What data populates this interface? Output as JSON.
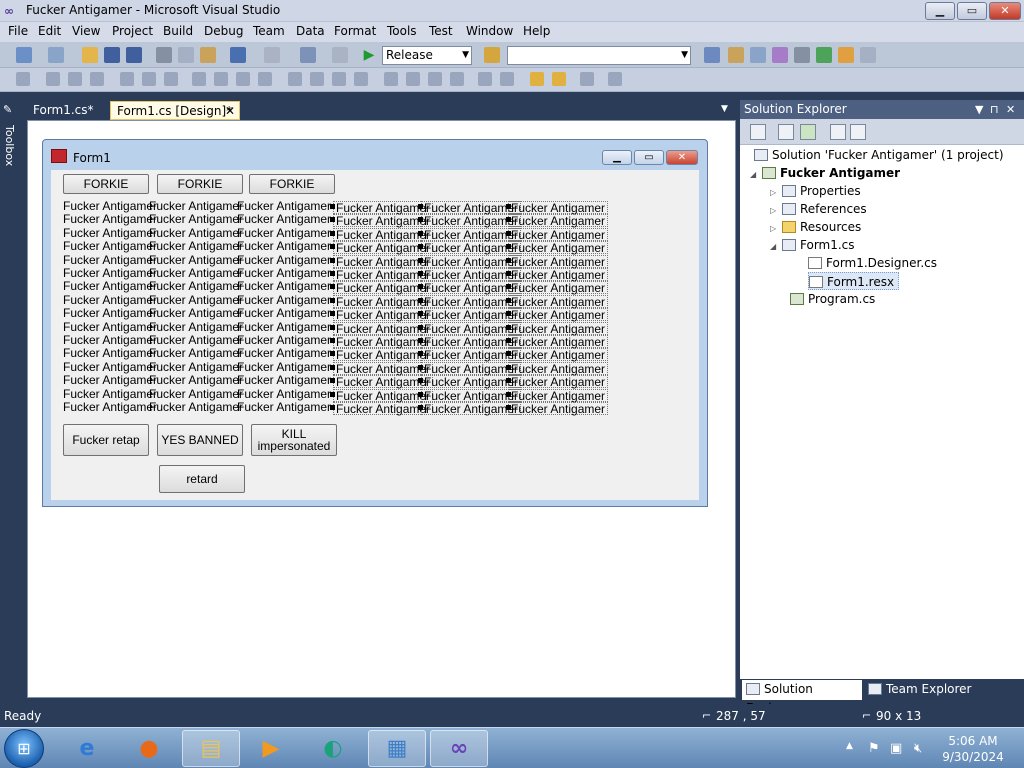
{
  "window": {
    "title": "Fucker Antigamer - Microsoft Visual Studio",
    "minimize": "▁",
    "maximize": "▭",
    "close": "✕"
  },
  "menu": [
    "File",
    "Edit",
    "View",
    "Project",
    "Build",
    "Debug",
    "Team",
    "Data",
    "Format",
    "Tools",
    "Test",
    "Window",
    "Help"
  ],
  "toolbar": {
    "config": "Release",
    "platform": ""
  },
  "toolbox_label": "Toolbox",
  "doc_tabs": {
    "tab1": "Form1.cs*",
    "tab2": "Form1.cs [Design]*",
    "tab2_close": "✕",
    "dropdown": "▼"
  },
  "form": {
    "title": "Form1",
    "top_buttons": [
      "FORKIE",
      "FORKIE",
      "FORKIE"
    ],
    "label_text": "Fucker Antigamer",
    "bottom_buttons": {
      "fucker_retap": "Fucker retap",
      "yes_banned": "YES BANNED",
      "kill_line1": "KILL",
      "kill_line2": "impersonated",
      "retard": "retard"
    }
  },
  "solution_explorer": {
    "title": "Solution Explorer",
    "pin": "⊓",
    "close": "✕",
    "dropdown": "▼",
    "tree": {
      "solution": "Solution 'Fucker Antigamer' (1 project)",
      "project": "Fucker Antigamer",
      "properties": "Properties",
      "references": "References",
      "resources": "Resources",
      "form1": "Form1.cs",
      "designer": "Form1.Designer.cs",
      "resx": "Form1.resx",
      "program": "Program.cs"
    },
    "tabs": [
      "Solution Explorer",
      "Team Explorer"
    ]
  },
  "status": {
    "ready": "Ready",
    "position": "287 , 57",
    "size": "90 x 13"
  },
  "taskbar": {
    "time": "5:06 AM",
    "date": "9/30/2024"
  },
  "icons": {
    "start": "windows-logo-icon",
    "ie": "internet-explorer-icon",
    "firefox": "firefox-icon",
    "explorer": "file-explorer-icon",
    "media": "media-player-icon",
    "app5": "app-icon",
    "control": "control-panel-icon",
    "vs": "visual-studio-icon"
  }
}
